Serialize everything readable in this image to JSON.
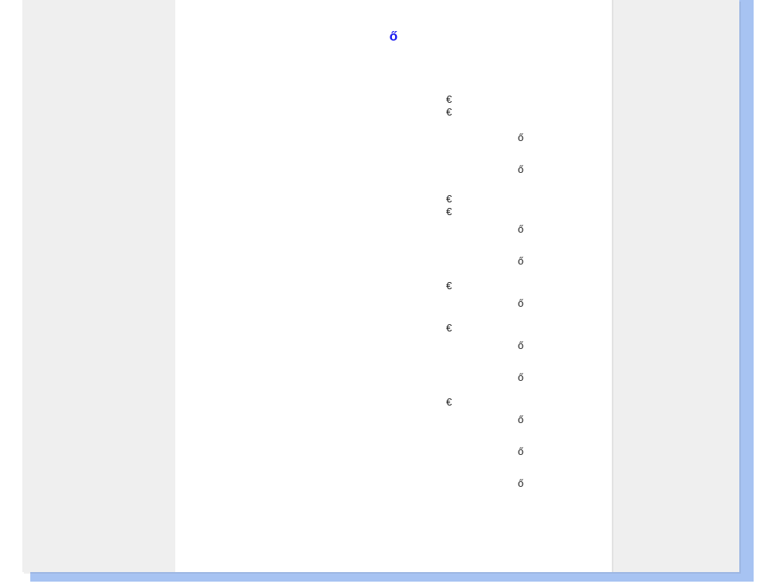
{
  "title_glyph": "ő",
  "euro_glyph": "€",
  "o_glyph": "ő",
  "euro_y_positions": [
    118,
    134,
    243,
    259,
    352,
    405,
    498
  ],
  "o_y_positions": [
    166,
    206,
    281,
    321,
    374,
    427,
    467,
    520,
    560,
    600
  ]
}
